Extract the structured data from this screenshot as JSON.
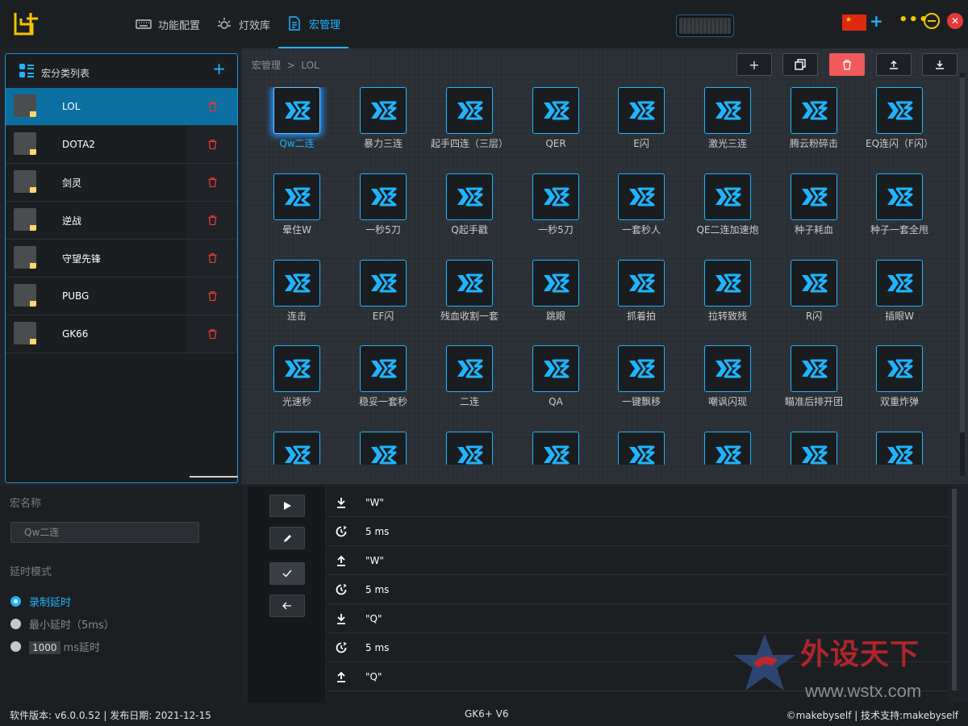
{
  "header": {
    "nav": [
      {
        "label": "功能配置",
        "icon": "keyboard-icon"
      },
      {
        "label": "灯效库",
        "icon": "light-icon"
      },
      {
        "label": "宏管理",
        "icon": "document-icon"
      }
    ],
    "active_nav": "宏管理"
  },
  "sidebar": {
    "title": "宏分类列表",
    "items": [
      {
        "label": "LOL",
        "active": true
      },
      {
        "label": "DOTA2"
      },
      {
        "label": "剑灵"
      },
      {
        "label": "逆战"
      },
      {
        "label": "守望先锋"
      },
      {
        "label": "PUBG"
      },
      {
        "label": "GK66"
      }
    ]
  },
  "breadcrumb": {
    "root": "宏管理",
    "sep": ">",
    "current": "LOL"
  },
  "toolbar": {
    "add": "+",
    "copy": "copy",
    "delete": "delete",
    "import": "import",
    "export": "export"
  },
  "macros": [
    "Qw二连",
    "暴力三连",
    "起手四连（三层）",
    "QER",
    "E闪",
    "激光三连",
    "腾云粉碎击",
    "EQ连闪（F闪）",
    "晕住W",
    "一秒5刀",
    "Q起手戳",
    "一秒5刀",
    "一套秒人",
    "QE二连加速炮",
    "种子耗血",
    "种子一套全甩",
    "连击",
    "EF闪",
    "残血收割一套",
    "跳眼",
    "抓着拍",
    "拉转致残",
    "R闪",
    "插眼W",
    "光速秒",
    "稳妥一套秒",
    "二连",
    "QA",
    "一键飘移",
    "嘲讽闪现",
    "瞄准后排开团",
    "双重炸弹",
    "",
    "",
    "",
    "",
    "",
    "",
    "",
    ""
  ],
  "editor": {
    "name_label": "宏名称",
    "name_value": "Qw二连",
    "delay_label": "延时模式",
    "options": [
      "录制延时",
      "最小延时（5ms）",
      "ms延时"
    ],
    "selected_option": "录制延时",
    "custom_ms": "1000"
  },
  "steps": [
    {
      "type": "down",
      "value": "\"W\""
    },
    {
      "type": "delay",
      "value": "5 ms"
    },
    {
      "type": "up",
      "value": "\"W\""
    },
    {
      "type": "delay",
      "value": "5 ms"
    },
    {
      "type": "down",
      "value": "\"Q\""
    },
    {
      "type": "delay",
      "value": "5 ms"
    },
    {
      "type": "up",
      "value": "\"Q\""
    }
  ],
  "watermark": {
    "text": "外设天下",
    "url": "www.wstx.com"
  },
  "status": {
    "left": "软件版本: v6.0.0.52 | 发布日期: 2021-12-15",
    "center": "GK6+ V6",
    "right": "©makebyself | 技术支持:makebyself"
  },
  "colors": {
    "accent": "#1fb4ff",
    "delete": "#f05a5a",
    "active_row": "#0c6fa1",
    "yellow": "#f3c400"
  }
}
